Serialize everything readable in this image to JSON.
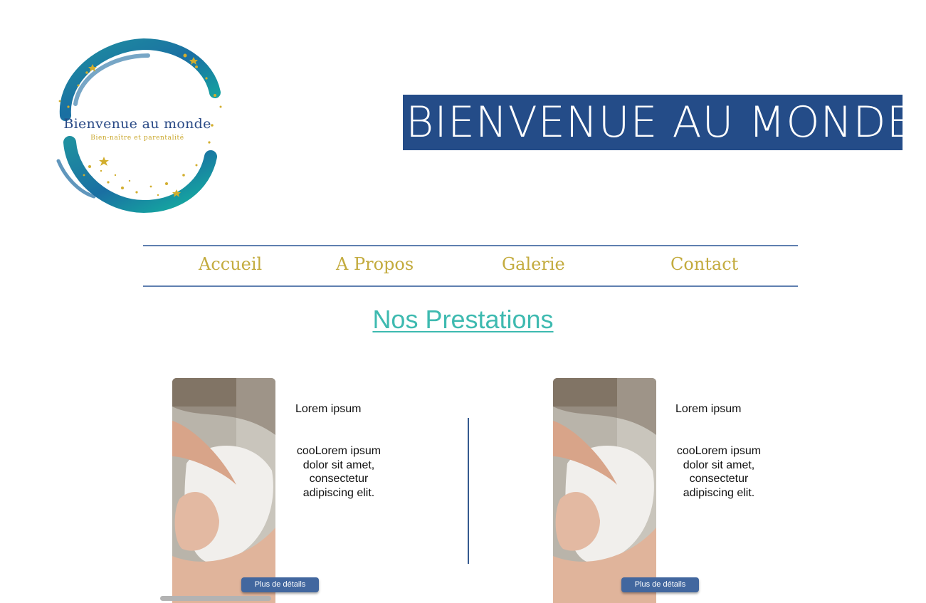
{
  "logo": {
    "title": "Bienvenue au monde",
    "subtitle": "Bien-naître et parentalité"
  },
  "banner": {
    "title": "BIENVENUE AU MONDE"
  },
  "nav": {
    "items": [
      {
        "label": "Accueil"
      },
      {
        "label": "A Propos"
      },
      {
        "label": "Galerie"
      },
      {
        "label": "Contact"
      }
    ]
  },
  "section": {
    "title": "Nos Prestations"
  },
  "cards": [
    {
      "heading": "Lorem ipsum",
      "text": "cooLorem ipsum dolor sit amet, consectetur adipiscing elit.",
      "button": "Plus de détails"
    },
    {
      "heading": "Lorem ipsum",
      "text": "cooLorem ipsum dolor sit amet, consectetur adipiscing elit.",
      "button": "Plus de détails"
    }
  ],
  "colors": {
    "banner_bg": "#244c88",
    "nav_text": "#c3ab3e",
    "section_title": "#3ebab0",
    "button_bg": "#42679f"
  }
}
